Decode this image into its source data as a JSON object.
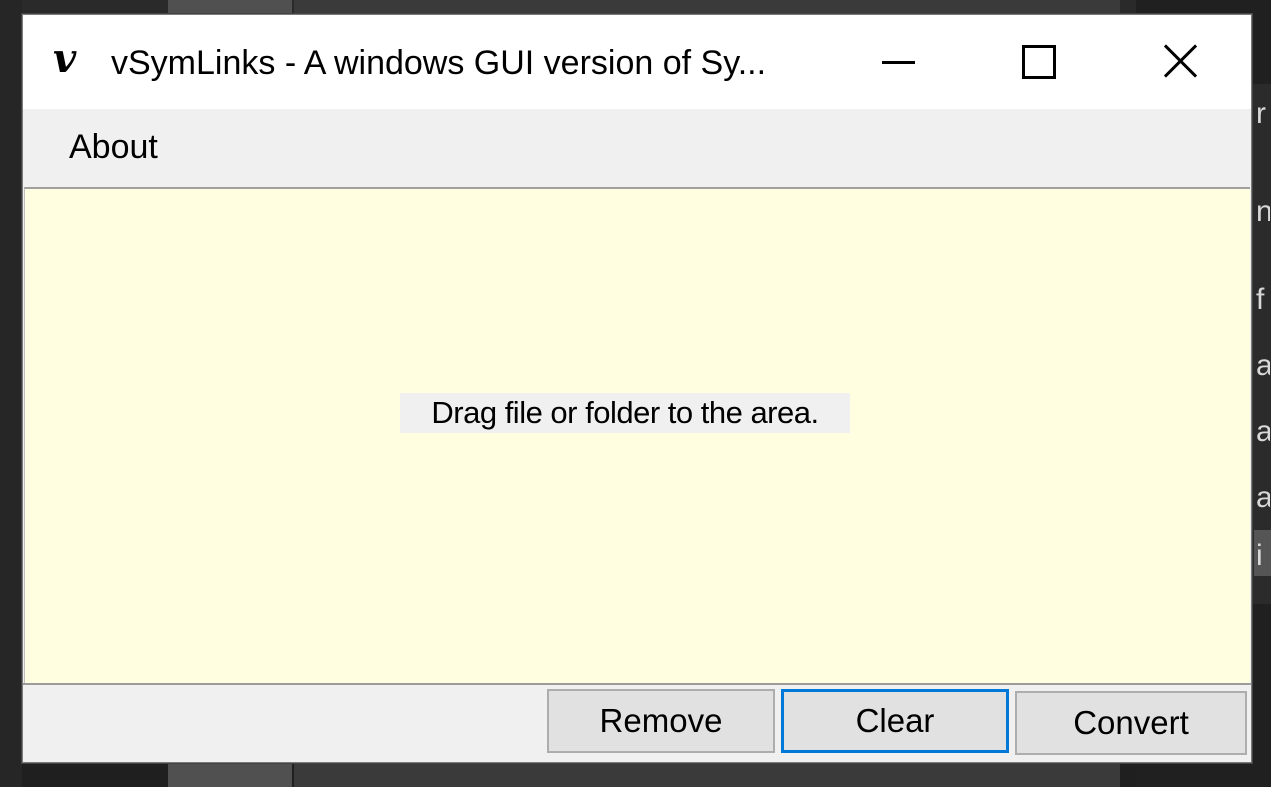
{
  "window": {
    "title": "vSymLinks - A windows GUI version of Sy...",
    "app_icon_glyph": "v",
    "controls": {
      "minimize": "minimize-icon",
      "maximize": "maximize-icon",
      "close": "close-icon"
    }
  },
  "menubar": {
    "items": [
      {
        "label": "About"
      }
    ]
  },
  "drop_area": {
    "hint": "Drag file or folder to the area.",
    "background_color": "#fffee0"
  },
  "buttons": {
    "remove": "Remove",
    "clear": "Clear",
    "convert": "Convert"
  },
  "colors": {
    "focus_border": "#0078d7",
    "button_face": "#e1e1e1"
  },
  "background": {
    "edge_glyphs": [
      "r",
      "n",
      "f",
      "a",
      "a",
      "a",
      "i"
    ]
  }
}
